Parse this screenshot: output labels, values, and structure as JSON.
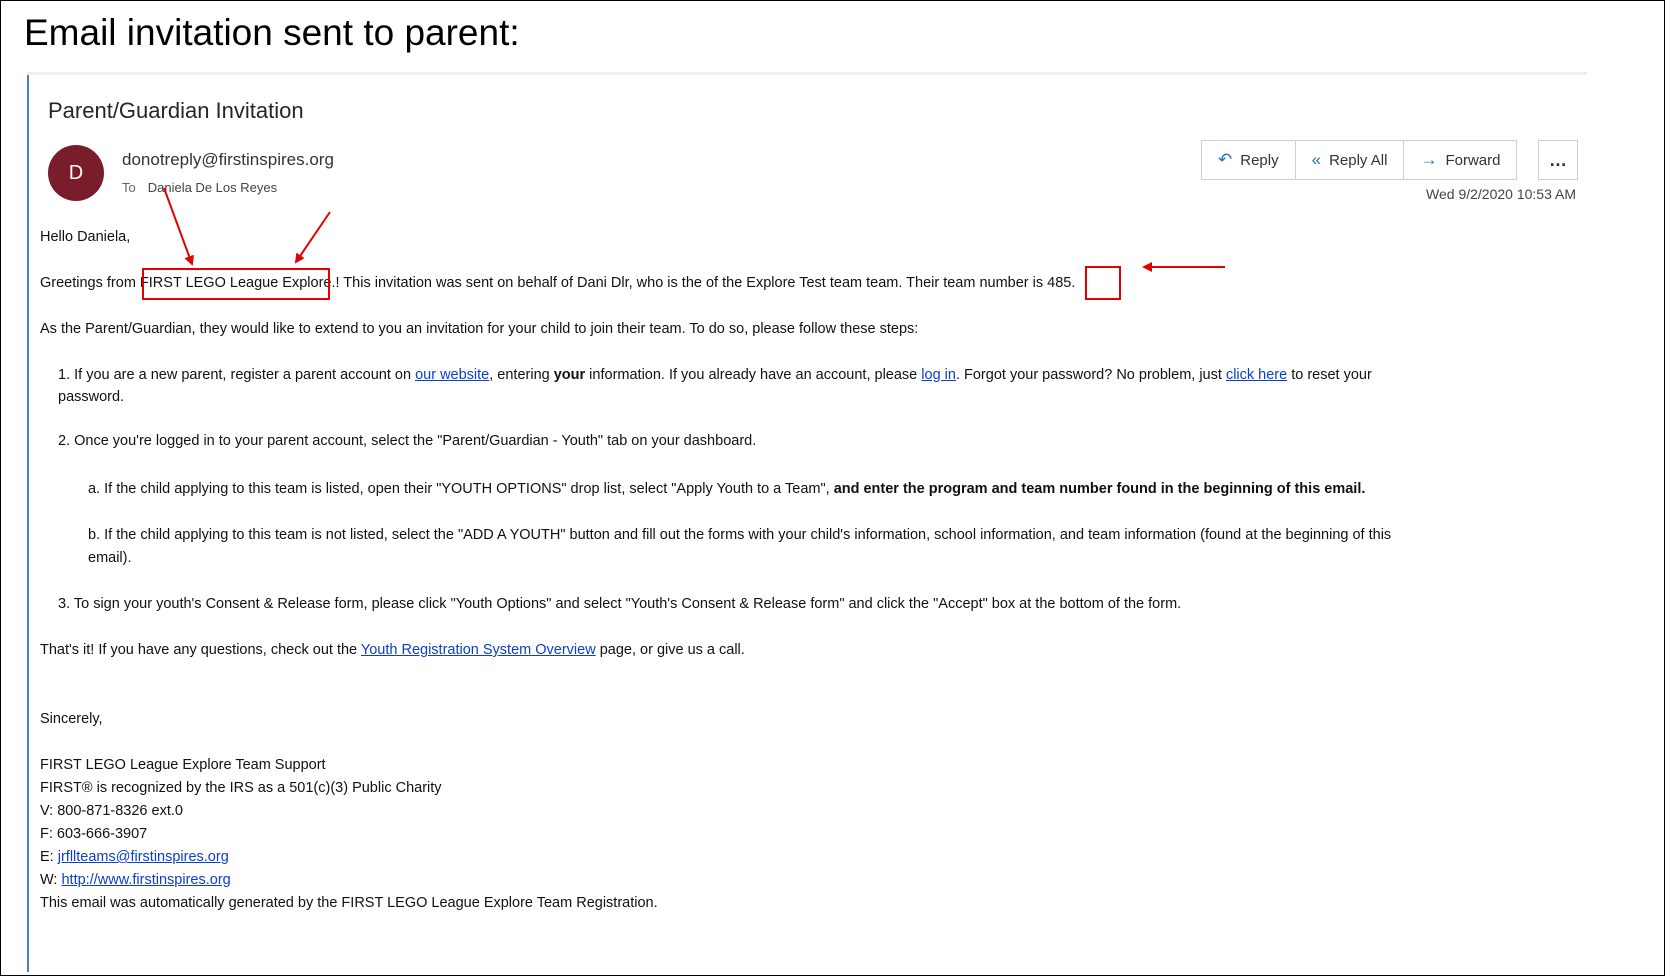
{
  "slide": {
    "title": "Email invitation sent to parent:"
  },
  "email": {
    "subject": "Parent/Guardian Invitation",
    "avatar_letter": "D",
    "sender": "donotreply@firstinspires.org",
    "to_label": "To",
    "recipient": "Daniela De Los Reyes",
    "timestamp": "Wed 9/2/2020 10:53 AM",
    "actions": {
      "reply": "Reply",
      "reply_all": "Reply All",
      "forward": "Forward",
      "more": "…"
    },
    "icons": {
      "reply": "reply-icon",
      "reply_all": "reply-all-icon",
      "forward": "forward-icon",
      "more": "more-icon"
    }
  },
  "body": {
    "greeting": "Hello Daniela,",
    "intro_before": "Greetings from ",
    "program": "FIRST LEGO League Explore",
    "intro_middle": ".! This invitation was sent on behalf of Dani Dlr, who is the of the Explore Test team team. Their team number is ",
    "team_number": "485.",
    "para2": "As the Parent/Guardian, they would like to extend to you an invitation for your child to join their team. To do so, please follow these steps:",
    "step1_a": "1. If you are a new parent, register a parent account on ",
    "step1_link1": "our website",
    "step1_b": ", entering ",
    "step1_bold": "your",
    "step1_c": " information. If you already have an account, please ",
    "step1_link2": "log in",
    "step1_d": ". Forgot your password? No problem, just ",
    "step1_link3": "click here",
    "step1_e": " to reset your",
    "step1_f": "password.",
    "step2": "2. Once you're logged in to your parent account, select the \"Parent/Guardian - Youth\" tab on your dashboard.",
    "step2a_plain": "a. If the child applying to this team is listed, open their \"YOUTH OPTIONS\" drop list, select \"Apply Youth to a Team\", ",
    "step2a_bold": "and enter the program and team number found in the beginning of this email.",
    "step2b_line1": "b. If the child applying to this team is not listed, select the \"ADD A YOUTH\" button and fill out the forms with your child's information, school information, and team information (found at the beginning of this",
    "step2b_line2": "email).",
    "step3": "3. To sign your youth's Consent & Release form, please click \"Youth Options\" and select \"Youth's Consent & Release form\" and click the \"Accept\" box at the bottom of the form.",
    "closing_a": "That's it! If you have any questions, check out the ",
    "closing_link": "Youth Registration System Overview",
    "closing_b": " page, or give us a call.",
    "sincerely": "Sincerely,",
    "sig_team": "FIRST LEGO League Explore Team Support",
    "sig_irs": "FIRST® is recognized by the IRS as a 501(c)(3) Public Charity",
    "sig_v": "V: 800-871-8326 ext.0",
    "sig_f": "F: 603-666-3907",
    "sig_e_label": "E: ",
    "sig_e_link": "jrfllteams@firstinspires.org",
    "sig_w_label": "W: ",
    "sig_w_link": "http://www.firstinspires.org",
    "sig_auto": "This email was automatically generated by the FIRST LEGO League Explore Team Registration."
  },
  "annotation": {
    "color": "#e30000"
  }
}
